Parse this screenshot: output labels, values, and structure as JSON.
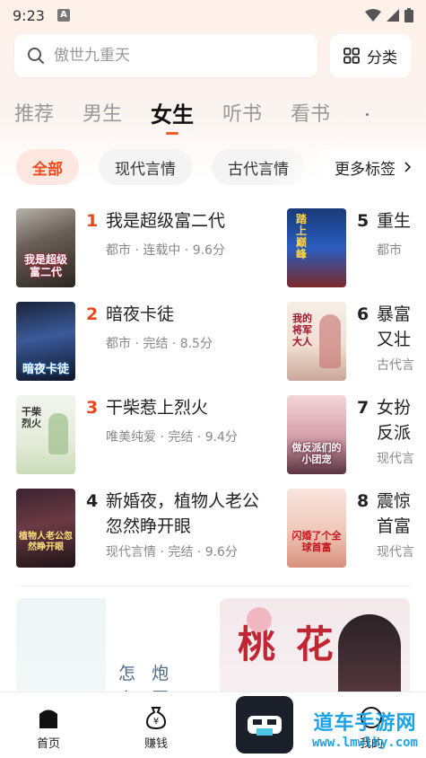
{
  "status_bar": {
    "time": "9:23",
    "notification_icon": "A"
  },
  "search": {
    "placeholder": "傲世九重天"
  },
  "category_button": {
    "label": "分类"
  },
  "tabs": [
    "推荐",
    "男生",
    "女生",
    "听书",
    "看书"
  ],
  "active_tab_index": 2,
  "chips": [
    "全部",
    "现代言情",
    "古代言情"
  ],
  "more_tags": "更多标签",
  "rank_list": [
    {
      "rank": "1",
      "title": "我是超级富二代",
      "meta": "都市 · 连载中 · 9.6分",
      "cover_text": "我是超级富二代"
    },
    {
      "rank": "2",
      "title": "暗夜卡徒",
      "meta": "都市 · 完结 · 8.5分",
      "cover_text": "暗夜卡徒"
    },
    {
      "rank": "3",
      "title": "干柴惹上烈火",
      "meta": "唯美纯爱 · 完结 · 9.4分",
      "cover_text": "干柴烈火"
    },
    {
      "rank": "4",
      "title": "新婚夜，植物人老公忽然睁开眼",
      "meta": "现代言情 · 完结 · 9.6分",
      "cover_text": "植物人老公忽然睁开眼"
    },
    {
      "rank": "5",
      "title": "重生",
      "meta": "都市",
      "cover_text": "踏上巅峰"
    },
    {
      "rank": "6",
      "title": "暴富又壮",
      "meta": "古代言",
      "cover_text": "我的将军大人"
    },
    {
      "rank": "7",
      "title": "女扮反派",
      "meta": "现代言",
      "cover_text": "做反派们的小团宠"
    },
    {
      "rank": "8",
      "title": "震惊首富",
      "meta": "现代言",
      "cover_text": "闪婚了个全球首富"
    }
  ],
  "banners": {
    "left_text": "怎 炮 么 区",
    "right_text": "桃 花"
  },
  "bottom_nav": {
    "home": "首页",
    "earn": "赚钱",
    "mine": "我的"
  },
  "watermark": {
    "site": "道车手游网",
    "url": "www.lmwlhy.com"
  },
  "colors": {
    "accent": "#e8471e",
    "chip_active_bg": "#fde7e0"
  }
}
